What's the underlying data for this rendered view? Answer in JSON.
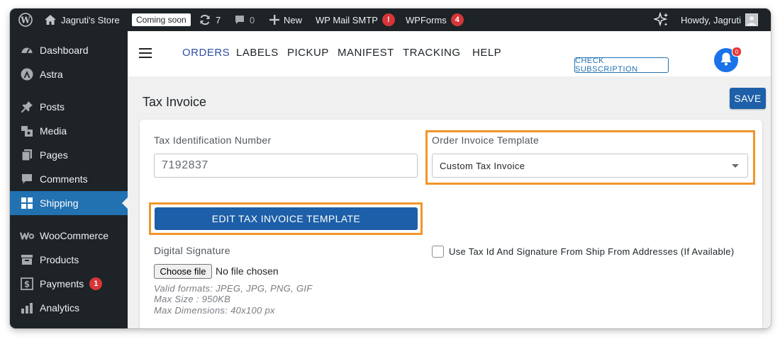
{
  "adminbar": {
    "site_name": "Jagruti's Store",
    "coming_soon": "Coming soon",
    "updates_count": "7",
    "comments_count": "0",
    "new_label": "New",
    "wp_mail_smtp": "WP Mail SMTP",
    "wp_mail_smtp_badge": "!",
    "wpforms": "WPForms",
    "wpforms_badge": "4",
    "howdy": "Howdy, Jagruti"
  },
  "sidebar": {
    "items": [
      {
        "label": "Dashboard",
        "icon": "dashboard-icon"
      },
      {
        "label": "Astra",
        "icon": "astra-icon"
      },
      {
        "label": "Posts",
        "icon": "pin-icon"
      },
      {
        "label": "Media",
        "icon": "media-icon"
      },
      {
        "label": "Pages",
        "icon": "pages-icon"
      },
      {
        "label": "Comments",
        "icon": "comment-icon"
      },
      {
        "label": "Shipping",
        "icon": "grid-icon",
        "active": true
      },
      {
        "label": "WooCommerce",
        "icon": "woocommerce-icon"
      },
      {
        "label": "Products",
        "icon": "archive-icon"
      },
      {
        "label": "Payments",
        "icon": "dollar-icon",
        "badge": "1"
      },
      {
        "label": "Analytics",
        "icon": "bar-chart-icon"
      }
    ]
  },
  "topnav": {
    "links": [
      "ORDERS",
      "LABELS",
      "PICKUP",
      "MANIFEST",
      "TRACKING",
      "HELP"
    ],
    "active": "ORDERS",
    "check_subscription": "CHECK SUBSCRIPTION",
    "notification_count": "0"
  },
  "page": {
    "title": "Tax Invoice",
    "save_label": "SAVE"
  },
  "form": {
    "tin_label": "Tax Identification Number",
    "tin_value": "7192837",
    "template_label": "Order Invoice Template",
    "template_value": "Custom Tax Invoice",
    "edit_button": "EDIT TAX INVOICE TEMPLATE",
    "signature_label": "Digital Signature",
    "choose_file": "Choose file",
    "file_status": "No file chosen",
    "hint_formats": "Valid formats: JPEG, JPG, PNG, GIF",
    "hint_size": "Max Size : 950KB",
    "hint_dimensions": "Max Dimensions: 40x100 px",
    "checkbox_label": "Use Tax Id And Signature From Ship From Addresses (If Available)",
    "checkbox_checked": false
  },
  "colors": {
    "admin_dark": "#1d2327",
    "wp_blue": "#2271b1",
    "button_blue": "#1d5fa8",
    "highlight_orange": "#f0962b",
    "badge_red": "#d63638"
  }
}
